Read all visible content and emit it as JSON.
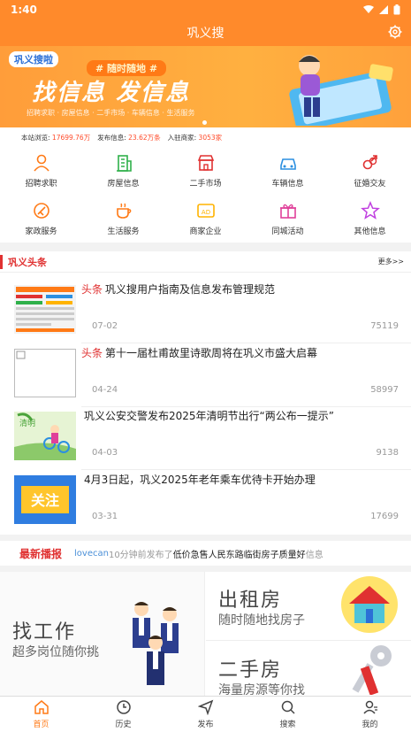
{
  "status": {
    "time": "1:40"
  },
  "header": {
    "title": "巩义搜"
  },
  "banner": {
    "logo": "巩义搜啦",
    "tagline": "# 随时随地 #",
    "slogan": "找信息 发信息",
    "sub": "招聘求职 · 房屋信息 · 二手市场 · 车辆信息 · 生活服务"
  },
  "stats": {
    "visits_label": "本站浏览:",
    "visits": "17699.76万",
    "posts_label": "发布信息:",
    "posts": "23.62万条",
    "merchants_label": "入驻商家:",
    "merchants": "3053家"
  },
  "categories": [
    {
      "label": "招聘求职",
      "icon": "person-icon",
      "color": "#ff7a16"
    },
    {
      "label": "房屋信息",
      "icon": "building-icon",
      "color": "#2fb04a"
    },
    {
      "label": "二手市场",
      "icon": "store-icon",
      "color": "#e03131"
    },
    {
      "label": "车辆信息",
      "icon": "car-icon",
      "color": "#2b8fe0"
    },
    {
      "label": "征婚交友",
      "icon": "gender-icon",
      "color": "#e03131"
    },
    {
      "label": "家政服务",
      "icon": "broom-icon",
      "color": "#ff7a16"
    },
    {
      "label": "生活服务",
      "icon": "cup-icon",
      "color": "#ff7a16"
    },
    {
      "label": "商家企业",
      "icon": "ad-icon",
      "color": "#ffb300"
    },
    {
      "label": "同城活动",
      "icon": "gift-icon",
      "color": "#e0409a"
    },
    {
      "label": "其他信息",
      "icon": "star-icon",
      "color": "#c040e0"
    }
  ],
  "headlines": {
    "title": "巩义头条",
    "more": "更多>>",
    "items": [
      {
        "tag": "头条",
        "title": "巩义搜用户指南及信息发布管理规范",
        "date": "07-02",
        "views": "75119"
      },
      {
        "tag": "头条",
        "title": "第十一届杜甫故里诗歌周将在巩义市盛大启幕",
        "date": "04-24",
        "views": "58997"
      },
      {
        "tag": "",
        "title": "巩义公安交警发布2025年清明节出行“两公布一提示”",
        "date": "04-03",
        "views": "9138"
      },
      {
        "tag": "",
        "title": "4月3日起，巩义2025年老年乘车优待卡开始办理",
        "date": "03-31",
        "views": "17699"
      }
    ]
  },
  "ticker": {
    "label": "最新播报",
    "user": "lovecan",
    "middle": "10分钟前发布了",
    "message": "低价急售人民东路临街房子质量好",
    "suffix": "信息"
  },
  "promo": {
    "job_title": "找工作",
    "job_sub": "超多岗位随你挑",
    "rent_title": "出租房",
    "rent_sub": "随时随地找房子",
    "second_title": "二手房",
    "second_sub": "海量房源等你找"
  },
  "tabs": [
    {
      "label": "首页",
      "icon": "home-icon"
    },
    {
      "label": "历史",
      "icon": "clock-icon"
    },
    {
      "label": "发布",
      "icon": "send-icon"
    },
    {
      "label": "搜索",
      "icon": "search-icon"
    },
    {
      "label": "我的",
      "icon": "user-icon"
    }
  ],
  "colors": {
    "brand": "#ff8a2b",
    "accent": "#e03131"
  }
}
